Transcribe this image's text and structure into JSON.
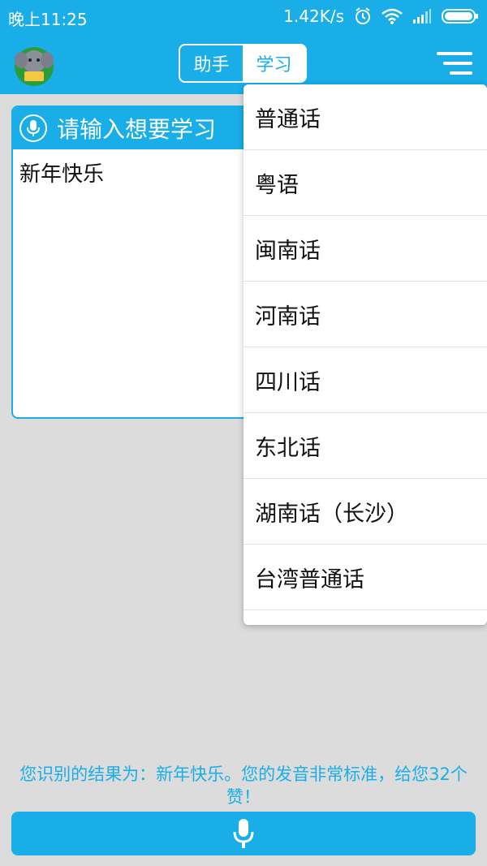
{
  "status_bar": {
    "time": "晚上11:25",
    "network_speed": "1.42K/s",
    "icons": [
      "alarm-icon",
      "wifi-icon",
      "signal-icon",
      "battery-icon"
    ]
  },
  "app_bar": {
    "tabs": [
      {
        "label": "助手",
        "active": false
      },
      {
        "label": "学习",
        "active": true
      }
    ],
    "menu_icon": "menu-icon"
  },
  "input_card": {
    "title": "请输入想要学习",
    "text": "新年快乐"
  },
  "dropdown": {
    "items": [
      "普通话",
      "粤语",
      "闽南话",
      "河南话",
      "四川话",
      "东北话",
      "湖南话（长沙）",
      "台湾普通话"
    ]
  },
  "result_text": "您识别的结果为：新年快乐。您的发音非常标准，给您32个赞！",
  "colors": {
    "accent": "#19aee8",
    "background": "#dcdcdc"
  }
}
